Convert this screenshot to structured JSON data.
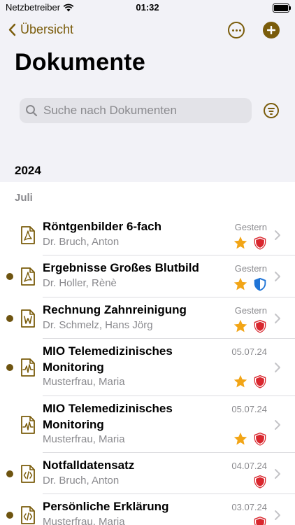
{
  "status": {
    "carrier": "Netzbetreiber",
    "time": "01:32"
  },
  "nav": {
    "back_label": "Übersicht"
  },
  "page": {
    "title": "Dokumente"
  },
  "search": {
    "placeholder": "Suche nach Dokumenten"
  },
  "section": {
    "year": "2024",
    "month": "Juli"
  },
  "documents": [
    {
      "title": "Röntgenbilder 6-fach",
      "author": "Dr. Bruch, Anton",
      "date": "Gestern",
      "unread": false,
      "type_icon": "pdf-icon",
      "starred": true,
      "shield": "red"
    },
    {
      "title": "Ergebnisse Großes Blutbild",
      "author": "Dr. Holler, Rènè",
      "date": "Gestern",
      "unread": true,
      "type_icon": "pdf-icon",
      "starred": true,
      "shield": "blue"
    },
    {
      "title": "Rechnung Zahnreinigung",
      "author": "Dr. Schmelz, Hans Jörg",
      "date": "Gestern",
      "unread": true,
      "type_icon": "word-icon",
      "starred": true,
      "shield": "red"
    },
    {
      "title": "MIO Telemedizinisches Monitoring",
      "author": "Musterfrau, Maria",
      "date": "05.07.24",
      "unread": true,
      "type_icon": "waveform-icon",
      "starred": true,
      "shield": "red"
    },
    {
      "title": "MIO Telemedizinisches Monitoring",
      "author": "Musterfrau, Maria",
      "date": "05.07.24",
      "unread": false,
      "type_icon": "waveform-icon",
      "starred": true,
      "shield": "red"
    },
    {
      "title": "Notfalldatensatz",
      "author": "Dr. Bruch, Anton",
      "date": "04.07.24",
      "unread": true,
      "type_icon": "code-icon",
      "starred": false,
      "shield": "red"
    },
    {
      "title": "Persönliche Erklärung",
      "author": "Musterfrau, Maria",
      "date": "03.07.24",
      "unread": true,
      "type_icon": "code-icon",
      "starred": false,
      "shield": "red"
    }
  ],
  "colors": {
    "accent": "#7a5c0b",
    "star": "#f2a516",
    "shield_red": "#d9272e",
    "shield_blue": "#1f74d6"
  }
}
